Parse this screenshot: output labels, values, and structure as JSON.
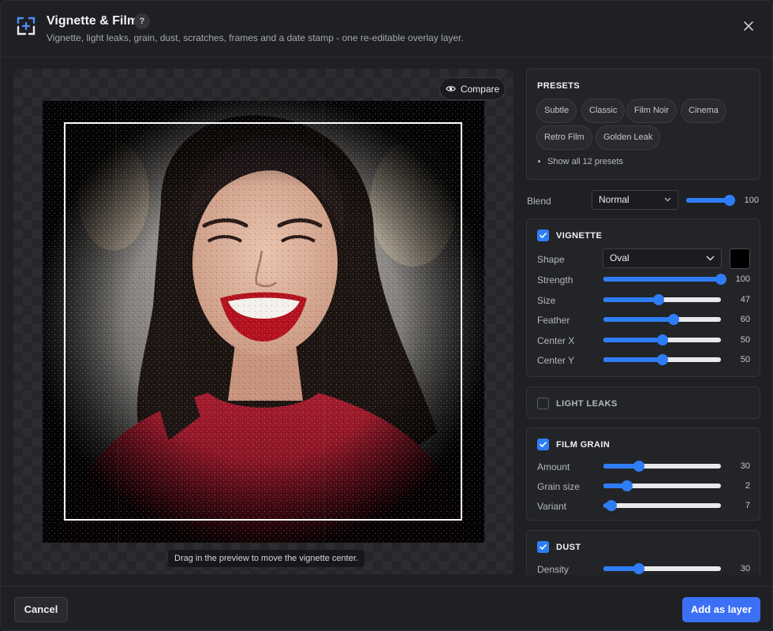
{
  "header": {
    "title": "Vignette & Film",
    "help": "?",
    "subtitle": "Vignette, light leaks, grain, dust, scratches, frames and a date stamp - one re-editable overlay layer.",
    "icons": {
      "app": "film-frame-icon",
      "close": "close-icon"
    }
  },
  "preview": {
    "compare_label": "Compare",
    "hint": "Drag in the preview to move the vignette center."
  },
  "presets": {
    "title": "PRESETS",
    "chips": [
      "Subtle",
      "Classic",
      "Film Noir",
      "Cinema",
      "Retro Film",
      "Golden Leak"
    ],
    "show_all": "Show all 12 presets"
  },
  "blend": {
    "label": "Blend",
    "mode": "Normal",
    "value": 100
  },
  "vignette": {
    "title": "VIGNETTE",
    "enabled": true,
    "shape_label": "Shape",
    "shape_value": "Oval",
    "color": "#000000",
    "rows": [
      {
        "label": "Strength",
        "value": 100
      },
      {
        "label": "Size",
        "value": 47
      },
      {
        "label": "Feather",
        "value": 60
      },
      {
        "label": "Center X",
        "value": 50
      },
      {
        "label": "Center Y",
        "value": 50
      }
    ]
  },
  "light_leaks": {
    "title": "LIGHT LEAKS",
    "enabled": false
  },
  "film_grain": {
    "title": "FILM GRAIN",
    "enabled": true,
    "rows": [
      {
        "label": "Amount",
        "value": 30
      },
      {
        "label": "Grain size",
        "value": 2
      },
      {
        "label": "Variant",
        "value": 7
      }
    ]
  },
  "dust": {
    "title": "DUST",
    "enabled": true,
    "rows": [
      {
        "label": "Density",
        "value": 30
      }
    ]
  },
  "footer": {
    "cancel": "Cancel",
    "add": "Add as layer"
  },
  "colors": {
    "accent": "#2f7df6",
    "primary_button": "#3b6ff5"
  }
}
